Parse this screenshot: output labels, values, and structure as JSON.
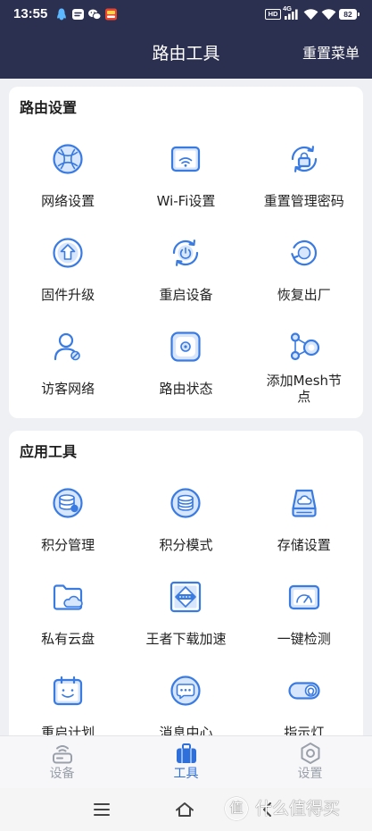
{
  "status_bar": {
    "time": "13:55",
    "left_icons": [
      "qq-icon",
      "message-icon",
      "wechat-icon",
      "shopping-app-icon"
    ],
    "hd": "HD",
    "network": "4G",
    "battery": "82"
  },
  "header": {
    "title": "路由工具",
    "action": "重置菜单"
  },
  "sections": [
    {
      "title": "路由设置",
      "items": [
        {
          "label": "网络设置",
          "icon": "globe-icon"
        },
        {
          "label": "Wi-Fi设置",
          "icon": "wifi-router-icon"
        },
        {
          "label": "重置管理密码",
          "icon": "lock-reset-icon"
        },
        {
          "label": "固件升级",
          "icon": "upgrade-arrow-icon"
        },
        {
          "label": "重启设备",
          "icon": "restart-power-icon"
        },
        {
          "label": "恢复出厂",
          "icon": "factory-reset-icon"
        },
        {
          "label": "访客网络",
          "icon": "guest-user-icon"
        },
        {
          "label": "路由状态",
          "icon": "router-status-icon"
        },
        {
          "label": "添加Mesh节点",
          "icon": "mesh-nodes-icon"
        }
      ]
    },
    {
      "title": "应用工具",
      "items": [
        {
          "label": "积分管理",
          "icon": "points-manage-icon"
        },
        {
          "label": "积分模式",
          "icon": "points-mode-icon"
        },
        {
          "label": "存储设置",
          "icon": "storage-cloud-icon"
        },
        {
          "label": "私有云盘",
          "icon": "cloud-folder-icon"
        },
        {
          "label": "王者下载加速",
          "icon": "game-boost-icon"
        },
        {
          "label": "一键检测",
          "icon": "speed-gauge-icon"
        },
        {
          "label": "重启计划",
          "icon": "calendar-icon"
        },
        {
          "label": "消息中心",
          "icon": "message-bubble-icon"
        },
        {
          "label": "指示灯",
          "icon": "indicator-light-icon"
        }
      ]
    }
  ],
  "tabbar": {
    "items": [
      {
        "label": "设备",
        "icon": "router-icon",
        "active": false
      },
      {
        "label": "工具",
        "icon": "toolbox-icon",
        "active": true
      },
      {
        "label": "设置",
        "icon": "gear-icon",
        "active": false
      }
    ]
  },
  "system_nav": {
    "icons": [
      "menu-icon",
      "home-icon",
      "back-icon"
    ]
  },
  "watermark": {
    "logo": "值",
    "text": "什么值得买"
  },
  "colors": {
    "header_bg": "#2c3050",
    "accent": "#2f6fdb",
    "icon_stroke": "#3a7be2",
    "icon_fill": "#d7e6fc",
    "page_bg": "#eef0f4",
    "tab_inactive": "#9aa0aa"
  }
}
